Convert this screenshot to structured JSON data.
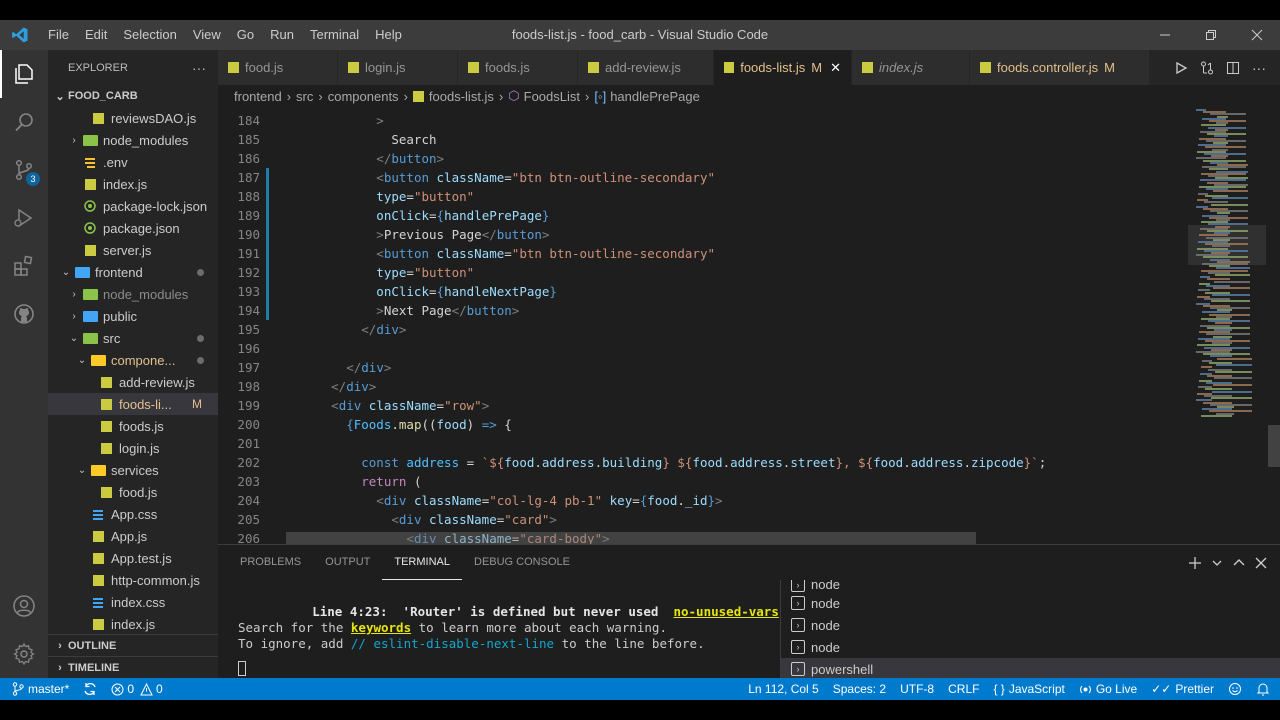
{
  "window": {
    "title": "foods-list.js - food_carb - Visual Studio Code"
  },
  "menu": [
    "File",
    "Edit",
    "Selection",
    "View",
    "Go",
    "Run",
    "Terminal",
    "Help"
  ],
  "sidebar": {
    "header": "EXPLORER",
    "more": "···",
    "folder": "FOOD_CARB",
    "tree": [
      {
        "label": "reviewsDAO.js",
        "type": "js",
        "indent": 2
      },
      {
        "label": "node_modules",
        "type": "folder-green",
        "indent": 1,
        "chevron": "›"
      },
      {
        "label": ".env",
        "type": "env",
        "indent": 1
      },
      {
        "label": "index.js",
        "type": "js",
        "indent": 1
      },
      {
        "label": "package-lock.json",
        "type": "json",
        "indent": 1
      },
      {
        "label": "package.json",
        "type": "json",
        "indent": 1
      },
      {
        "label": "server.js",
        "type": "js",
        "indent": 1
      },
      {
        "label": "frontend",
        "type": "folder-blue-open",
        "indent": 0,
        "chevron": "⌄",
        "dot": true
      },
      {
        "label": "node_modules",
        "type": "folder-green",
        "indent": 1,
        "chevron": "›",
        "dim": true
      },
      {
        "label": "public",
        "type": "folder-blue",
        "indent": 1,
        "chevron": "›"
      },
      {
        "label": "src",
        "type": "folder-green-open",
        "indent": 1,
        "chevron": "⌄",
        "dot": true
      },
      {
        "label": "compone...",
        "type": "folder-yellow-open",
        "indent": 2,
        "chevron": "⌄",
        "dot": true,
        "mod": true
      },
      {
        "label": "add-review.js",
        "type": "js",
        "indent": 3
      },
      {
        "label": "foods-li...",
        "type": "js",
        "indent": 3,
        "selected": true,
        "mod": true,
        "flag": "M"
      },
      {
        "label": "foods.js",
        "type": "js",
        "indent": 3
      },
      {
        "label": "login.js",
        "type": "js",
        "indent": 3
      },
      {
        "label": "services",
        "type": "folder-yellow-open",
        "indent": 2,
        "chevron": "⌄"
      },
      {
        "label": "food.js",
        "type": "js",
        "indent": 3
      },
      {
        "label": "App.css",
        "type": "css",
        "indent": 2
      },
      {
        "label": "App.js",
        "type": "js",
        "indent": 2
      },
      {
        "label": "App.test.js",
        "type": "js",
        "indent": 2
      },
      {
        "label": "http-common.js",
        "type": "js",
        "indent": 2
      },
      {
        "label": "index.css",
        "type": "css",
        "indent": 2
      },
      {
        "label": "index.js",
        "type": "js",
        "indent": 2
      }
    ],
    "outline": "OUTLINE",
    "timeline": "TIMELINE"
  },
  "tabs": [
    {
      "label": "food.js",
      "width": 120
    },
    {
      "label": "login.js",
      "width": 120
    },
    {
      "label": "foods.js",
      "width": 120
    },
    {
      "label": "add-review.js",
      "width": 136
    },
    {
      "label": "foods-list.js",
      "flag": "M",
      "active": true,
      "close": "✕",
      "width": 138
    },
    {
      "label": "index.js",
      "italic": true,
      "width": 118
    },
    {
      "label": "foods.controller.js",
      "flag": "M",
      "width": 180
    }
  ],
  "breadcrumb": [
    "frontend",
    "src",
    "components",
    "foods-list.js",
    "FoodsList",
    "handlePrePage"
  ],
  "editor": {
    "lines": [
      {
        "n": "184",
        "tokens": [
          [
            "punc",
            "            >"
          ]
        ]
      },
      {
        "n": "185",
        "tokens": [
          [
            "text",
            "              Search"
          ]
        ]
      },
      {
        "n": "186",
        "tokens": [
          [
            "punc",
            "            </"
          ],
          [
            "tag",
            "button"
          ],
          [
            "punc",
            ">"
          ]
        ]
      },
      {
        "n": "187",
        "tokens": [
          [
            "punc",
            "            <"
          ],
          [
            "tag",
            "button"
          ],
          [
            "text",
            " "
          ],
          [
            "attr",
            "className"
          ],
          [
            "text",
            "="
          ],
          [
            "str",
            "\"btn btn-outline-secondary\""
          ]
        ],
        "git": true
      },
      {
        "n": "188",
        "tokens": [
          [
            "attr",
            "            type"
          ],
          [
            "text",
            "="
          ],
          [
            "str",
            "\"button\""
          ]
        ],
        "git": true
      },
      {
        "n": "189",
        "tokens": [
          [
            "attr",
            "            onClick"
          ],
          [
            "text",
            "="
          ],
          [
            "brace",
            "{"
          ],
          [
            "var",
            "handlePrePage"
          ],
          [
            "brace",
            "}"
          ]
        ],
        "git": true
      },
      {
        "n": "190",
        "tokens": [
          [
            "punc",
            "            >"
          ],
          [
            "text",
            "Previous Page"
          ],
          [
            "punc",
            "</"
          ],
          [
            "tag",
            "button"
          ],
          [
            "punc",
            ">"
          ]
        ],
        "git": true
      },
      {
        "n": "191",
        "tokens": [
          [
            "punc",
            "            <"
          ],
          [
            "tag",
            "button"
          ],
          [
            "text",
            " "
          ],
          [
            "attr",
            "className"
          ],
          [
            "text",
            "="
          ],
          [
            "str",
            "\"btn btn-outline-secondary\""
          ]
        ],
        "git": true
      },
      {
        "n": "192",
        "tokens": [
          [
            "attr",
            "            type"
          ],
          [
            "text",
            "="
          ],
          [
            "str",
            "\"button\""
          ]
        ],
        "git": true
      },
      {
        "n": "193",
        "tokens": [
          [
            "attr",
            "            onClick"
          ],
          [
            "text",
            "="
          ],
          [
            "brace",
            "{"
          ],
          [
            "var",
            "handleNextPage"
          ],
          [
            "brace",
            "}"
          ]
        ],
        "git": true
      },
      {
        "n": "194",
        "tokens": [
          [
            "punc",
            "            >"
          ],
          [
            "text",
            "Next Page"
          ],
          [
            "punc",
            "</"
          ],
          [
            "tag",
            "button"
          ],
          [
            "punc",
            ">"
          ]
        ],
        "git": true
      },
      {
        "n": "195",
        "tokens": [
          [
            "punc",
            "          </"
          ],
          [
            "tag",
            "div"
          ],
          [
            "punc",
            ">"
          ]
        ]
      },
      {
        "n": "196",
        "tokens": [
          [
            "text",
            ""
          ]
        ]
      },
      {
        "n": "197",
        "tokens": [
          [
            "punc",
            "        </"
          ],
          [
            "tag",
            "div"
          ],
          [
            "punc",
            ">"
          ]
        ]
      },
      {
        "n": "198",
        "tokens": [
          [
            "punc",
            "      </"
          ],
          [
            "tag",
            "div"
          ],
          [
            "punc",
            ">"
          ]
        ]
      },
      {
        "n": "199",
        "tokens": [
          [
            "punc",
            "      <"
          ],
          [
            "tag",
            "div"
          ],
          [
            "text",
            " "
          ],
          [
            "attr",
            "className"
          ],
          [
            "text",
            "="
          ],
          [
            "str",
            "\"row\""
          ],
          [
            "punc",
            ">"
          ]
        ]
      },
      {
        "n": "200",
        "tokens": [
          [
            "brace",
            "        {"
          ],
          [
            "const",
            "Foods"
          ],
          [
            "text",
            "."
          ],
          [
            "fn",
            "map"
          ],
          [
            "text",
            "(("
          ],
          [
            "var",
            "food"
          ],
          [
            "text",
            ") "
          ],
          [
            "tag",
            "=>"
          ],
          [
            "text",
            " {"
          ]
        ]
      },
      {
        "n": "201",
        "tokens": [
          [
            "text",
            ""
          ]
        ]
      },
      {
        "n": "202",
        "tokens": [
          [
            "tag",
            "          const"
          ],
          [
            "text",
            " "
          ],
          [
            "const",
            "address"
          ],
          [
            "text",
            " = "
          ],
          [
            "str",
            "`${"
          ],
          [
            "var",
            "food"
          ],
          [
            "text",
            "."
          ],
          [
            "var",
            "address"
          ],
          [
            "text",
            "."
          ],
          [
            "var",
            "building"
          ],
          [
            "str",
            "} ${"
          ],
          [
            "var",
            "food"
          ],
          [
            "text",
            "."
          ],
          [
            "var",
            "address"
          ],
          [
            "text",
            "."
          ],
          [
            "var",
            "street"
          ],
          [
            "str",
            "}, ${"
          ],
          [
            "var",
            "food"
          ],
          [
            "text",
            "."
          ],
          [
            "var",
            "address"
          ],
          [
            "text",
            "."
          ],
          [
            "var",
            "zipcode"
          ],
          [
            "str",
            "}`"
          ],
          [
            "text",
            ";"
          ]
        ]
      },
      {
        "n": "203",
        "tokens": [
          [
            "kw",
            "          return"
          ],
          [
            "text",
            " ("
          ]
        ]
      },
      {
        "n": "204",
        "tokens": [
          [
            "punc",
            "            <"
          ],
          [
            "tag",
            "div"
          ],
          [
            "text",
            " "
          ],
          [
            "attr",
            "className"
          ],
          [
            "text",
            "="
          ],
          [
            "str",
            "\"col-lg-4 pb-1\""
          ],
          [
            "text",
            " "
          ],
          [
            "attr",
            "key"
          ],
          [
            "text",
            "="
          ],
          [
            "brace",
            "{"
          ],
          [
            "var",
            "food"
          ],
          [
            "text",
            "."
          ],
          [
            "var",
            "_id"
          ],
          [
            "brace",
            "}"
          ],
          [
            "punc",
            ">"
          ]
        ]
      },
      {
        "n": "205",
        "tokens": [
          [
            "punc",
            "              <"
          ],
          [
            "tag",
            "div"
          ],
          [
            "text",
            " "
          ],
          [
            "attr",
            "className"
          ],
          [
            "text",
            "="
          ],
          [
            "str",
            "\"card\""
          ],
          [
            "punc",
            ">"
          ]
        ]
      },
      {
        "n": "206",
        "tokens": [
          [
            "punc",
            "                <"
          ],
          [
            "tag",
            "div"
          ],
          [
            "text",
            " "
          ],
          [
            "attr",
            "className"
          ],
          [
            "text",
            "="
          ],
          [
            "str",
            "\"card-body\""
          ],
          [
            "punc",
            ">"
          ]
        ]
      }
    ]
  },
  "panel": {
    "tabs": [
      "PROBLEMS",
      "OUTPUT",
      "TERMINAL",
      "DEBUG CONSOLE"
    ],
    "active": "TERMINAL",
    "terminal": {
      "line1_loc": "Line 4:23:",
      "line1_msg": "'Router' is defined but never used",
      "line1_rule": "no-unused-vars",
      "line2_a": "Search for the ",
      "line2_kw": "keywords",
      "line2_b": " to learn more about each warning.",
      "line3_a": "To ignore, add ",
      "line3_cmt": "// eslint-disable-next-line",
      "line3_b": " to the line before."
    },
    "sessions": [
      "node",
      "node",
      "node",
      "node",
      "powershell"
    ]
  },
  "status": {
    "branch": "master*",
    "errors": "0",
    "warnings": "0",
    "position": "Ln 112, Col 5",
    "spaces": "Spaces: 2",
    "encoding": "UTF-8",
    "eol": "CRLF",
    "language": "JavaScript",
    "golive": "Go Live",
    "prettier": "Prettier"
  },
  "colors": {
    "accent": "#007acc",
    "activity": "#333333",
    "sidebar": "#252526",
    "editor": "#1e1e1e"
  }
}
